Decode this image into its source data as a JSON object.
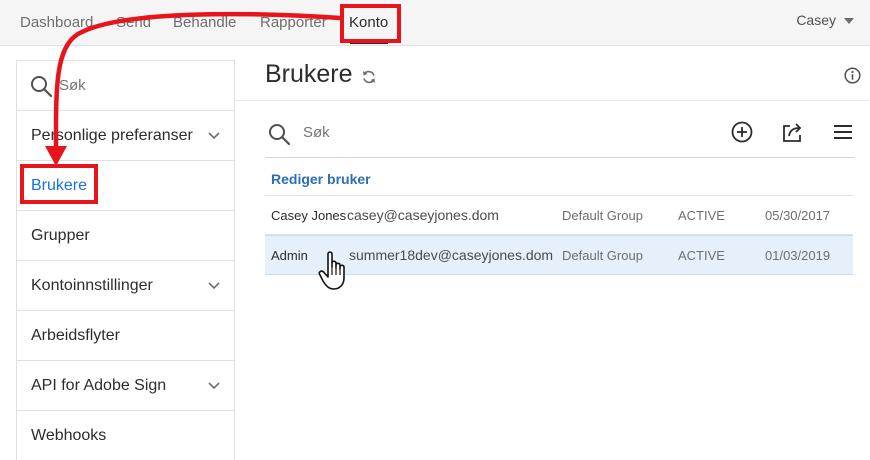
{
  "topnav": {
    "items": [
      {
        "label": "Dashboard"
      },
      {
        "label": "Send"
      },
      {
        "label": "Behandle"
      },
      {
        "label": "Rapporter"
      },
      {
        "label": "Konto"
      }
    ],
    "user": "Casey"
  },
  "sidebar": {
    "search_placeholder": "Søk",
    "items": [
      {
        "label": "Personlige preferanser",
        "expandable": true
      },
      {
        "label": "Brukere",
        "selected": true
      },
      {
        "label": "Grupper"
      },
      {
        "label": "Kontoinnstillinger",
        "expandable": true
      },
      {
        "label": "Arbeidsflyter"
      },
      {
        "label": "API for Adobe Sign",
        "expandable": true
      },
      {
        "label": "Webhooks"
      }
    ]
  },
  "main": {
    "title": "Brukere",
    "search_placeholder": "Søk",
    "table_title": "Rediger bruker",
    "rows": [
      {
        "name": "Casey Jones",
        "email": "casey@caseyjones.dom",
        "group": "Default Group",
        "status": "ACTIVE",
        "date": "05/30/2017"
      },
      {
        "name": "Admin",
        "email": "summer18dev@caseyjones.dom",
        "group": "Default Group",
        "status": "ACTIVE",
        "date": "01/03/2019"
      }
    ]
  },
  "colors": {
    "accent": "#1473e6",
    "highlight": "#e8141b",
    "selected_row": "#e6f0fb"
  }
}
